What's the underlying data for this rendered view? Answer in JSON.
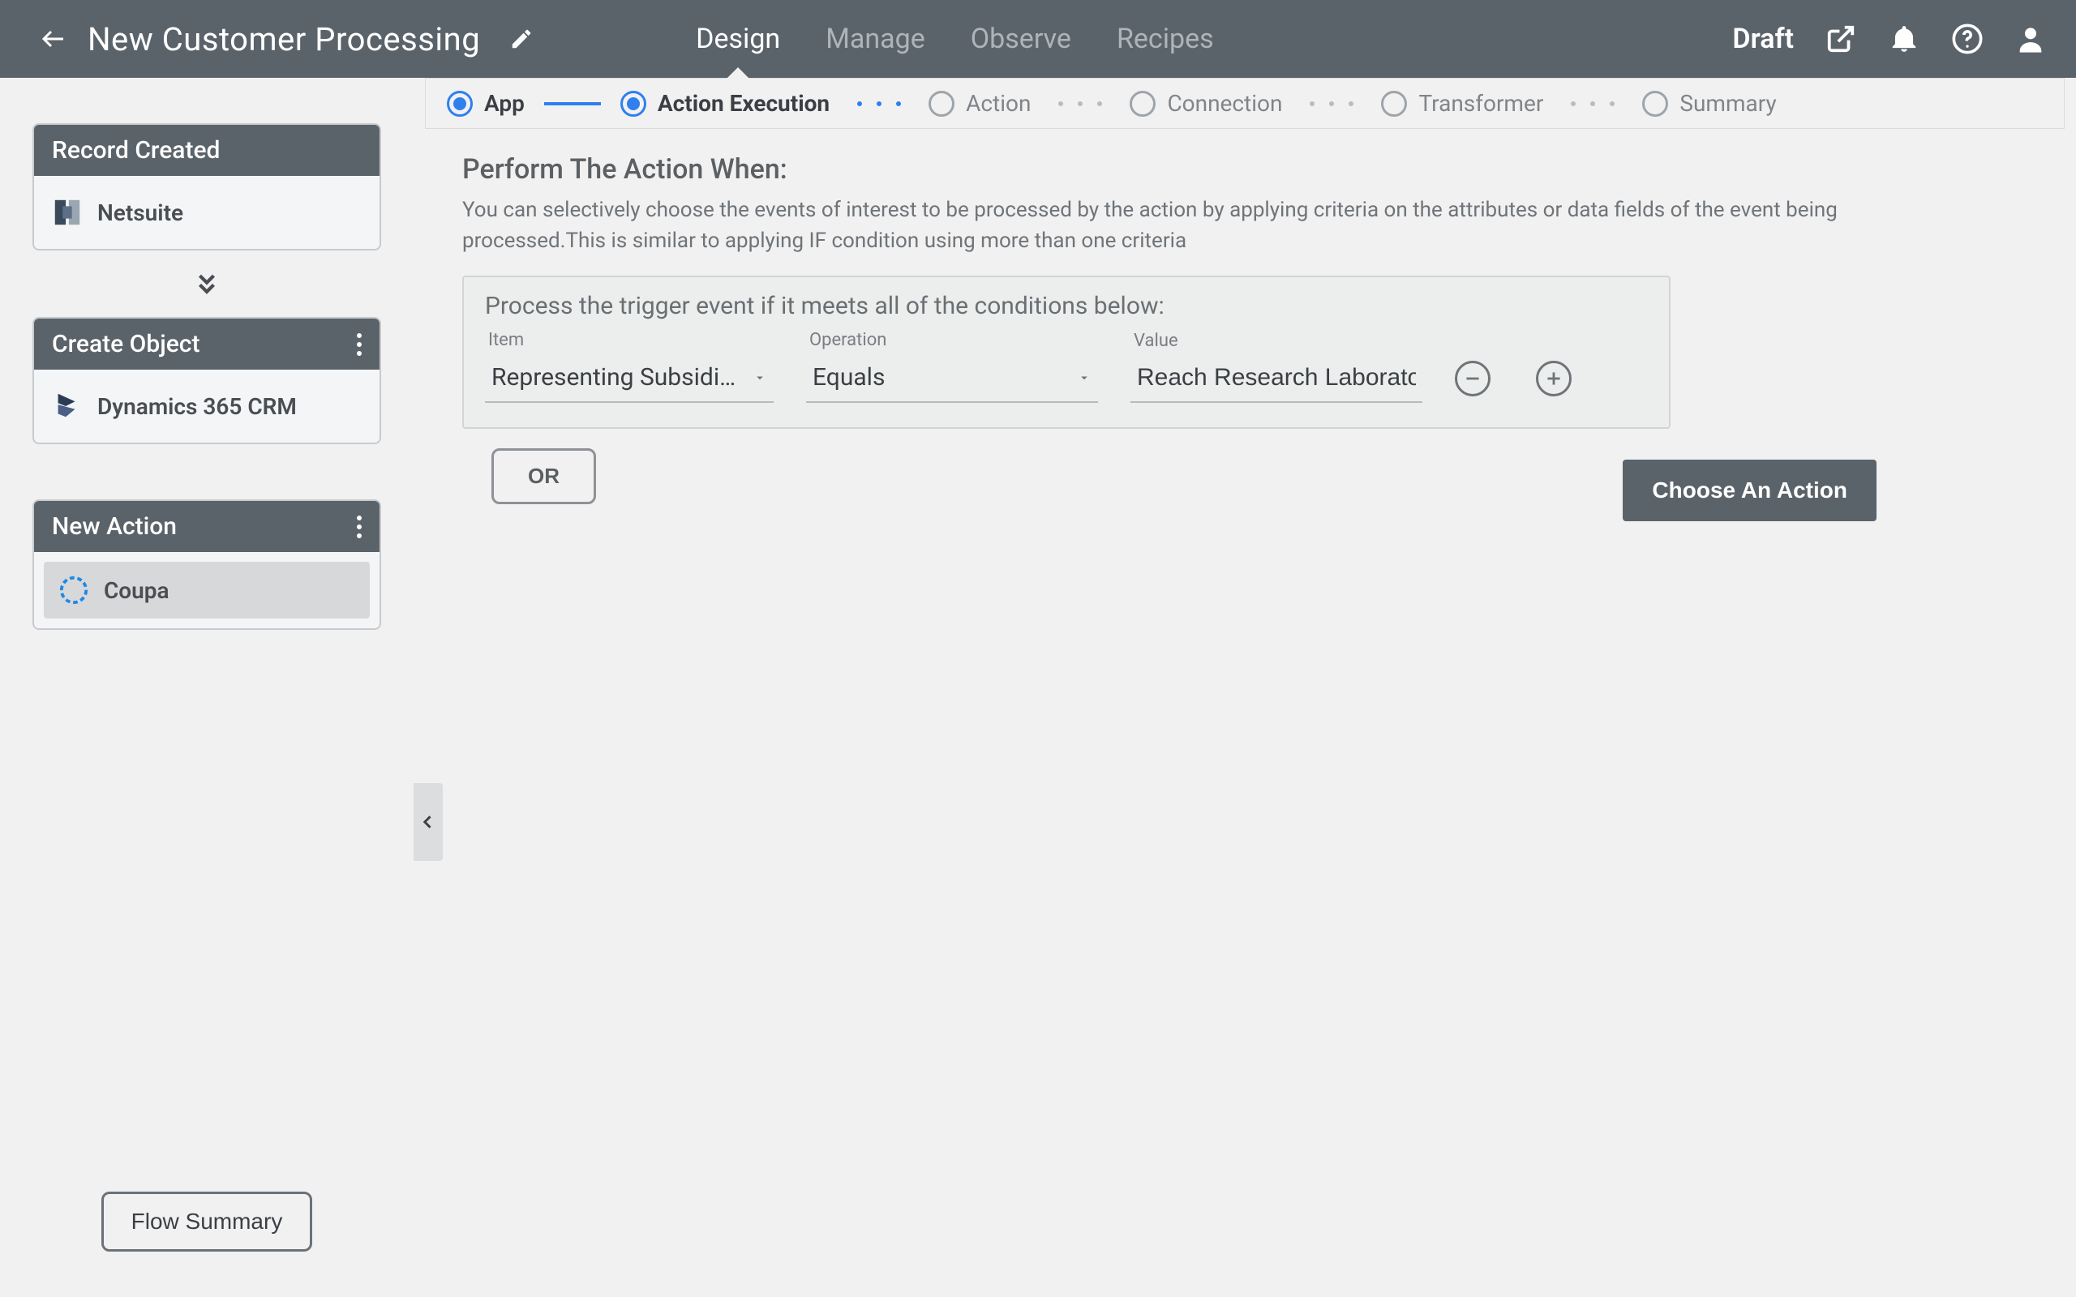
{
  "header": {
    "title": "New Customer Processing",
    "tabs": [
      "Design",
      "Manage",
      "Observe",
      "Recipes"
    ],
    "active_tab": 0,
    "status": "Draft"
  },
  "sidebar": {
    "cards": [
      {
        "title": "Record Created",
        "app": "Netsuite",
        "menu": false,
        "active": false
      },
      {
        "title": "Create Object",
        "app": "Dynamics 365 CRM",
        "menu": true,
        "active": false
      },
      {
        "title": "New Action",
        "app": "Coupa",
        "menu": true,
        "active": true
      }
    ],
    "flow_summary_label": "Flow Summary"
  },
  "stepper": {
    "steps": [
      "App",
      "Action Execution",
      "Action",
      "Connection",
      "Transformer",
      "Summary"
    ],
    "done_index": 0,
    "active_index": 1
  },
  "panel": {
    "title": "Perform The Action When:",
    "description": "You can selectively choose the events of interest to be processed by the action by applying criteria on the attributes or data fields of the event being processed.This is similar to applying IF condition using more than one criteria",
    "criteria_title": "Process the trigger event if it meets all of the conditions below:",
    "labels": {
      "item": "Item",
      "operation": "Operation",
      "value": "Value"
    },
    "row": {
      "item": "Representing Subsidi…",
      "operation": "Equals",
      "value": "Reach Research Laboratori"
    },
    "or_label": "OR",
    "choose_action_label": "Choose An Action"
  }
}
